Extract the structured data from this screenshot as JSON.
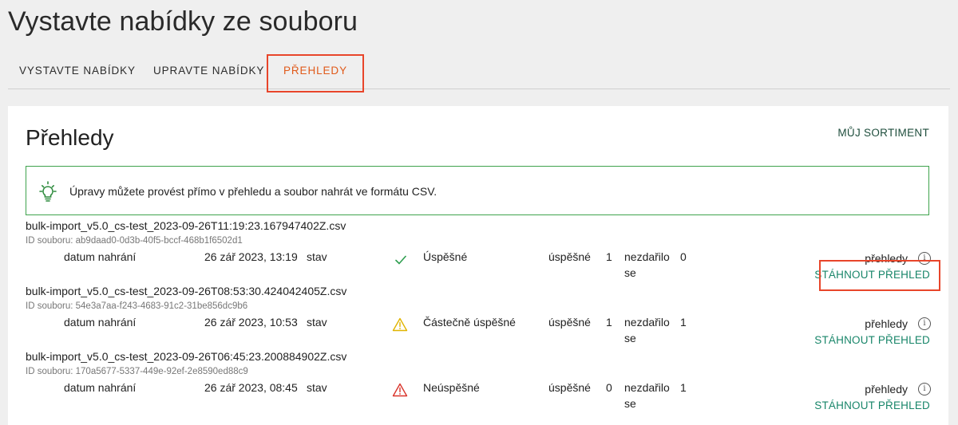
{
  "page": {
    "title": "Vystavte nabídky ze souboru"
  },
  "tabs": [
    {
      "label": "VYSTAVTE NABÍDKY"
    },
    {
      "label": "UPRAVTE NABÍDKY"
    },
    {
      "label": "PŘEHLEDY",
      "active": true
    }
  ],
  "card": {
    "title": "Přehledy",
    "sortiment_link": "MŮJ SORTIMENT",
    "info_text": "Úpravy můžete provést přímo v přehledu a soubor nahrát ve formátu CSV."
  },
  "labels": {
    "upload_date": "datum nahrání",
    "status": "stav",
    "success_count": "úspěšné",
    "failed_count_line1": "nezdařilo",
    "failed_count_line2": "se",
    "reports": "přehledy",
    "download": "STÁHNOUT PŘEHLED",
    "info_symbol": "i"
  },
  "colors": {
    "active_tab": "#e05a1a",
    "link": "#19866a",
    "success": "#2e9e4f",
    "warning": "#e0b400",
    "error": "#d9342b",
    "highlight": "#e8452a"
  },
  "files": [
    {
      "name": "bulk-import_v5.0_cs-test_2023-09-26T11:19:23.167947402Z.csv",
      "id": "ID souboru: ab9daad0-0d3b-40f5-bccf-468b1f6502d1",
      "date": "26 zář 2023, 13:19",
      "status": "Úspěšné",
      "status_icon": "checkmark-icon",
      "success": "1",
      "failed": "0"
    },
    {
      "name": "bulk-import_v5.0_cs-test_2023-09-26T08:53:30.424042405Z.csv",
      "id": "ID souboru: 54e3a7aa-f243-4683-91c2-31be856dc9b6",
      "date": "26 zář 2023, 10:53",
      "status": "Částečně úspěšné",
      "status_icon": "warning-icon",
      "success": "1",
      "failed": "1"
    },
    {
      "name": "bulk-import_v5.0_cs-test_2023-09-26T06:45:23.200884902Z.csv",
      "id": "ID souboru: 170a5677-5337-449e-92ef-2e8590ed88c9",
      "date": "26 zář 2023, 08:45",
      "status": "Neúspěšné",
      "status_icon": "error-icon",
      "success": "0",
      "failed": "1"
    }
  ]
}
